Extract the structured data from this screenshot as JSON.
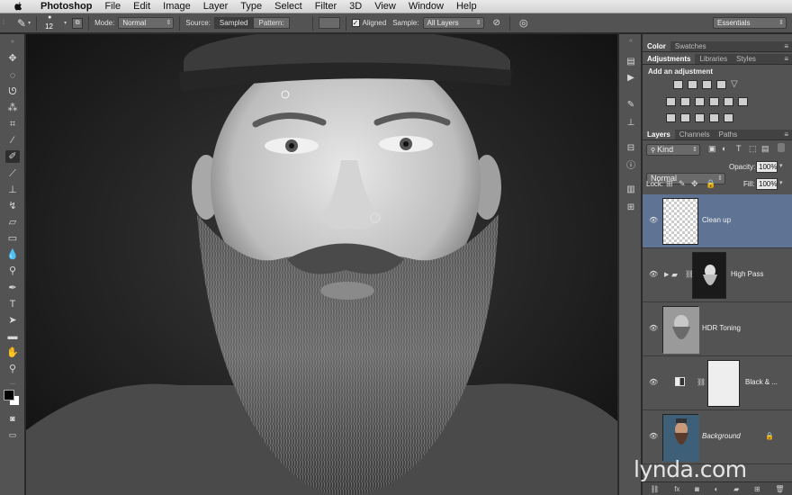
{
  "menubar": {
    "app": "Photoshop",
    "items": [
      "File",
      "Edit",
      "Image",
      "Layer",
      "Type",
      "Select",
      "Filter",
      "3D",
      "View",
      "Window",
      "Help"
    ]
  },
  "options": {
    "brush_size": "12",
    "mode_label": "Mode:",
    "mode_value": "Normal",
    "source_label": "Source:",
    "source_sampled": "Sampled",
    "source_pattern": "Pattern:",
    "aligned_label": "Aligned",
    "aligned_checked": true,
    "sample_label": "Sample:",
    "sample_value": "All Layers",
    "workspace": "Essentials"
  },
  "panels": {
    "color_tabs": [
      "Color",
      "Swatches"
    ],
    "adjust_tabs": [
      "Adjustments",
      "Libraries",
      "Styles"
    ],
    "add_adjustment": "Add an adjustment",
    "layer_tabs": [
      "Layers",
      "Channels",
      "Paths"
    ],
    "filter_kind": "Kind",
    "blend_mode": "Normal",
    "opacity_label": "Opacity:",
    "opacity_value": "100%",
    "lock_label": "Lock:",
    "fill_label": "Fill:",
    "fill_value": "100%"
  },
  "layers": [
    {
      "name": "Clean up",
      "selected": true
    },
    {
      "name": "High Pass",
      "selected": false,
      "group": true
    },
    {
      "name": "HDR Toning",
      "selected": false
    },
    {
      "name": "Black & ...",
      "selected": false,
      "adjustment": true
    },
    {
      "name": "Background",
      "selected": false,
      "locked": true
    }
  ],
  "watermark": "lynda.com",
  "colors": {
    "panel_bg": "#535353",
    "selected_layer": "#5f7494",
    "menubar": "#dedede"
  }
}
